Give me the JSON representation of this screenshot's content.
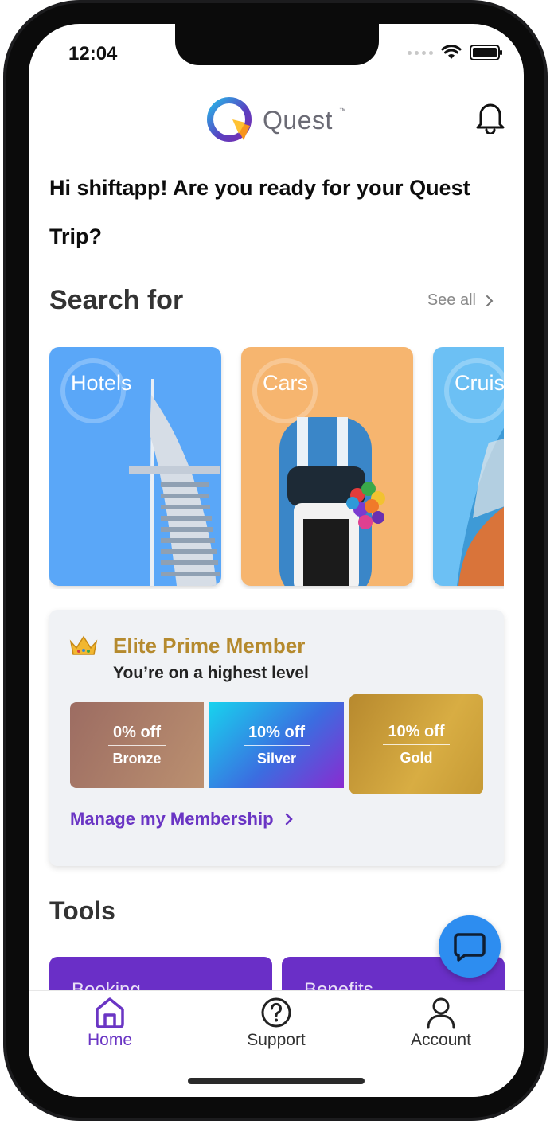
{
  "status_bar": {
    "time": "12:04"
  },
  "header": {
    "logo_text": "Quest",
    "logo_tm": "™"
  },
  "greeting": {
    "line1": "Hi shiftapp! Are you ready for your Quest",
    "line2": "Trip?"
  },
  "search_section": {
    "title": "Search for",
    "see_all": "See all",
    "categories": [
      {
        "label": "Hotels",
        "color": "#5aa7f8"
      },
      {
        "label": "Cars",
        "color": "#f6b56f"
      },
      {
        "label": "Cruis",
        "color": "#6cc0f4"
      }
    ]
  },
  "membership": {
    "title": "Elite Prime Member",
    "subtitle": "You’re on a highest level",
    "tiers": [
      {
        "discount": "0% off",
        "name": "Bronze"
      },
      {
        "discount": "10% off",
        "name": "Silver"
      },
      {
        "discount": "10% off",
        "name": "Gold"
      }
    ],
    "manage_link": "Manage my Membership",
    "accent_color": "#b58a2e",
    "link_color": "#6a35c4"
  },
  "tools": {
    "title": "Tools",
    "cards": [
      {
        "label": "Booking"
      },
      {
        "label": "Benefits"
      }
    ]
  },
  "tab_bar": {
    "items": [
      {
        "label": "Home",
        "icon": "home-icon",
        "active": true
      },
      {
        "label": "Support",
        "icon": "help-circle-icon",
        "active": false
      },
      {
        "label": "Account",
        "icon": "user-icon",
        "active": false
      }
    ]
  }
}
